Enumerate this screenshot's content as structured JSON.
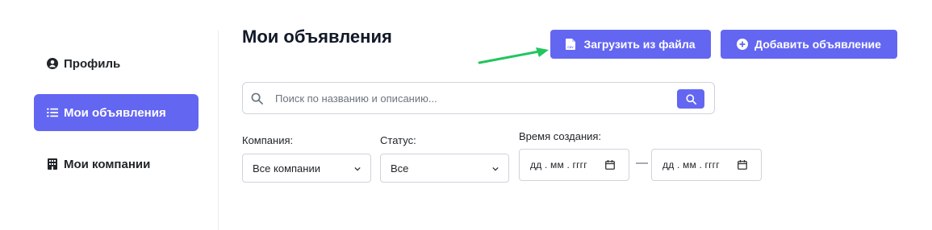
{
  "sidebar": {
    "items": [
      {
        "label": "Профиль",
        "icon": "user-circle-icon",
        "active": false
      },
      {
        "label": "Мои объявления",
        "icon": "list-icon",
        "active": true
      },
      {
        "label": "Мои компании",
        "icon": "building-icon",
        "active": false
      }
    ]
  },
  "header": {
    "title": "Мои объявления",
    "upload_label": "Загрузить из файла",
    "add_label": "Добавить объявление"
  },
  "search": {
    "placeholder": "Поиск по названию и описанию...",
    "value": ""
  },
  "filters": {
    "company_label": "Компания:",
    "company_value": "Все компании",
    "status_label": "Статус:",
    "status_value": "Все",
    "time_label": "Время создания:",
    "date_from": "дд . мм . гггг",
    "date_to": "дд . мм . гггг",
    "range_separator": "—"
  },
  "colors": {
    "accent": "#6366f1",
    "annotation_arrow": "#22c55e"
  }
}
